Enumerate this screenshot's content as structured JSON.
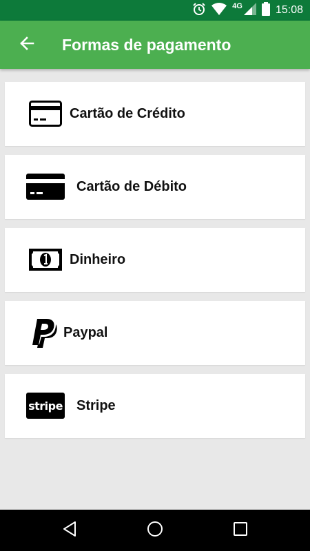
{
  "status_bar": {
    "time": "15:08",
    "network": "4G",
    "icons": [
      "alarm-icon",
      "wifi-icon",
      "cell-signal-icon",
      "battery-icon"
    ]
  },
  "app_bar": {
    "title": "Formas de pagamento",
    "back_icon": "arrow-back-icon",
    "color": "#4caf50"
  },
  "payment_methods": [
    {
      "label": "Cartão de Crédito",
      "icon": "credit-card-icon"
    },
    {
      "label": "Cartão de Débito",
      "icon": "debit-card-icon"
    },
    {
      "label": "Dinheiro",
      "icon": "cash-icon"
    },
    {
      "label": "Paypal",
      "icon": "paypal-icon"
    },
    {
      "label": "Stripe",
      "icon": "stripe-logo",
      "logo_text": "stripe"
    }
  ],
  "nav_bar": {
    "buttons": [
      "back-triangle-icon",
      "home-circle-icon",
      "recents-square-icon"
    ]
  },
  "colors": {
    "status_bar": "#0d7a3a",
    "app_bar": "#4caf50",
    "background": "#e8e8e8"
  }
}
